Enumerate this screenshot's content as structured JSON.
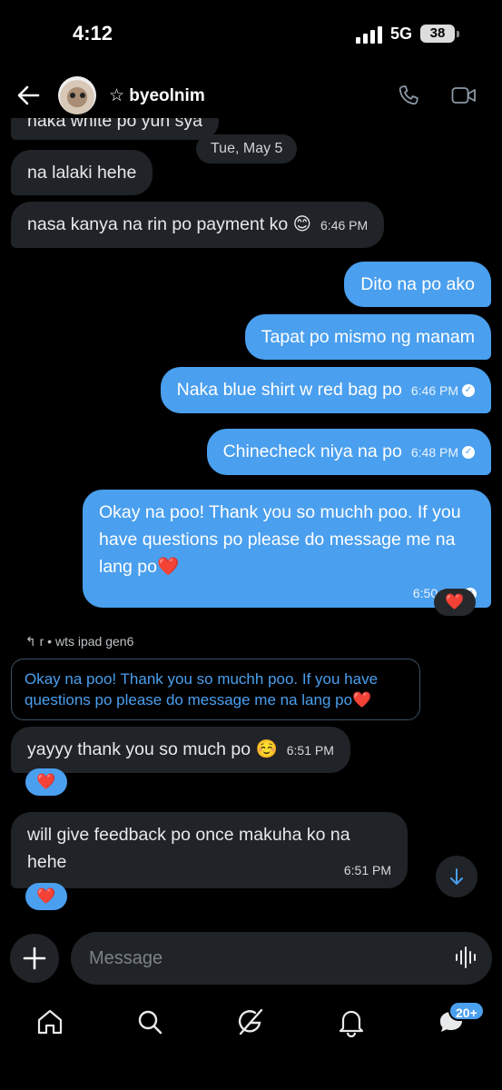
{
  "status": {
    "time": "4:12",
    "network": "5G",
    "battery": "38"
  },
  "header": {
    "contact_name": "☆ byeolnim"
  },
  "chat": {
    "date_separator": "Tue, May 5",
    "partial_top_text": "naka white po yun sya",
    "messages": [
      {
        "text": "na lalaki hehe",
        "time": ""
      },
      {
        "text": "nasa kanya na rin po payment ko 😊",
        "time": "6:46 PM"
      },
      {
        "text": "Dito na po ako",
        "time": ""
      },
      {
        "text": "Tapat po mismo ng manam",
        "time": ""
      },
      {
        "text": "Naka blue shirt w red bag po",
        "time": "6:46 PM"
      },
      {
        "text": "Chinecheck niya na po",
        "time": "6:48 PM"
      },
      {
        "text": "Okay na poo! Thank you so muchh poo. If you have questions po please do message me na lang po❤️",
        "time": "6:50 PM"
      },
      {
        "text": "yayyy thank you so much po ☺️",
        "time": "6:51 PM"
      },
      {
        "text": "will give feedback po once makuha ko na hehe",
        "time": "6:51 PM"
      }
    ],
    "reactions": {
      "heart": "❤️"
    },
    "reply": {
      "label": "r • wts ipad gen6",
      "quoted": "Okay na poo! Thank you so muchh poo. If you have questions po please do message me na lang po❤️"
    }
  },
  "composer": {
    "placeholder": "Message"
  },
  "nav": {
    "messages_badge": "20+"
  },
  "colors": {
    "accent": "#4a9fee",
    "incoming_bubble": "#202327",
    "background": "#000000"
  },
  "icons": [
    "back-arrow-icon",
    "phone-icon",
    "video-camera-icon",
    "plus-icon",
    "voice-wave-icon",
    "home-icon",
    "search-icon",
    "grok-icon",
    "bell-icon",
    "messages-icon",
    "chevron-down-icon",
    "check-circle-icon"
  ]
}
